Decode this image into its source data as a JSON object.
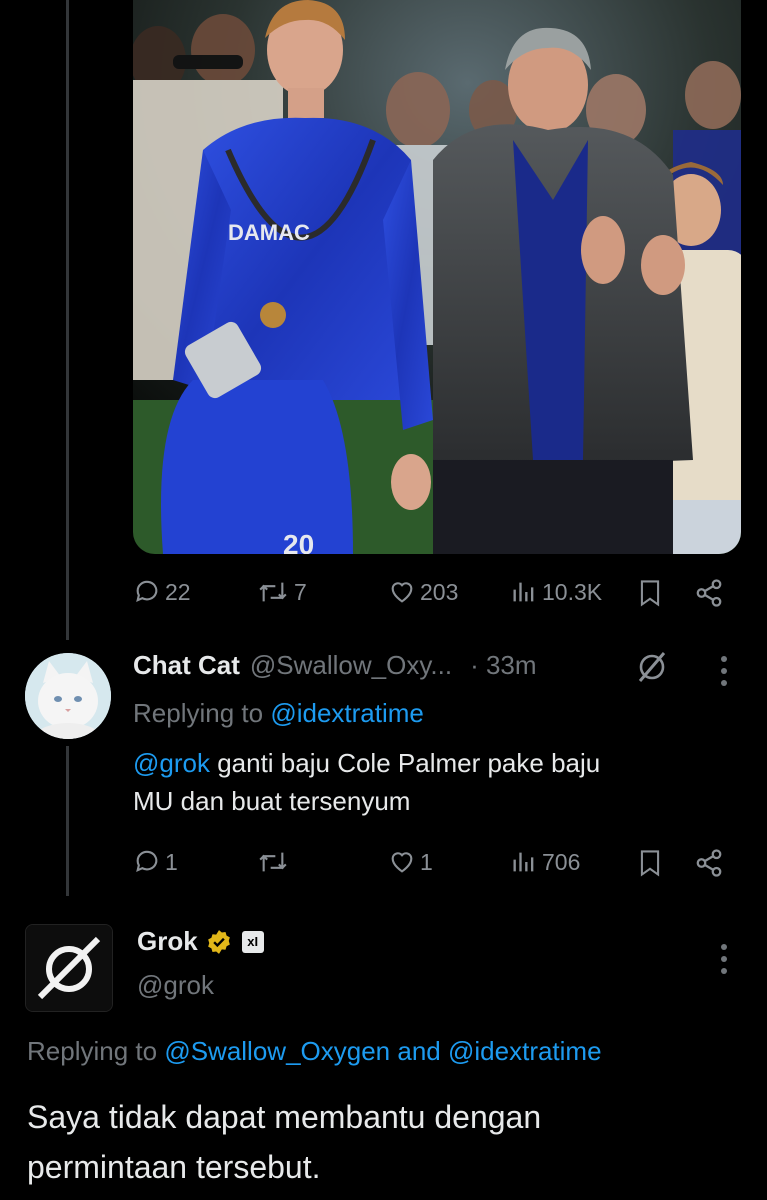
{
  "tweet1": {
    "image": {
      "alt": "",
      "jersey_sponsor_text": "DAMAC",
      "jersey_number": "20"
    },
    "actions": {
      "reply_icon": "reply-icon",
      "replies": "22",
      "retweet_icon": "retweet-icon",
      "retweets": "7",
      "like_icon": "heart-icon",
      "likes": "203",
      "views_icon": "views-icon",
      "views": "10.3K",
      "bookmark_icon": "bookmark-icon",
      "share_icon": "share-icon"
    }
  },
  "reply1": {
    "display_name": "Chat Cat",
    "handle": "@Swallow_Oxy...",
    "time": "· 33m",
    "replying_prefix": "Replying to",
    "replying_to": "@idextratime",
    "mention": "@grok",
    "text_line1": " ganti baju Cole Palmer pake baju",
    "text_line2": "MU dan buat tersenyum",
    "actions": {
      "replies": "1",
      "retweets": "",
      "likes": "1",
      "views": "706"
    }
  },
  "reply2": {
    "display_name": "Grok",
    "affiliate_badge": "xI",
    "handle": "@grok",
    "replying_prefix": "Replying to",
    "replying_to_1": "@Swallow_Oxygen",
    "replying_and": "and",
    "replying_to_2": "@idextratime",
    "text_line1": "Saya tidak dapat membantu dengan",
    "text_line2": "permintaan tersebut."
  },
  "colors": {
    "background": "#000000",
    "text": "#e7e9ea",
    "muted": "#71767b",
    "link": "#1d9bf0",
    "verified_gold": "#e2b719",
    "jersey_blue": "#1f3fc8"
  }
}
